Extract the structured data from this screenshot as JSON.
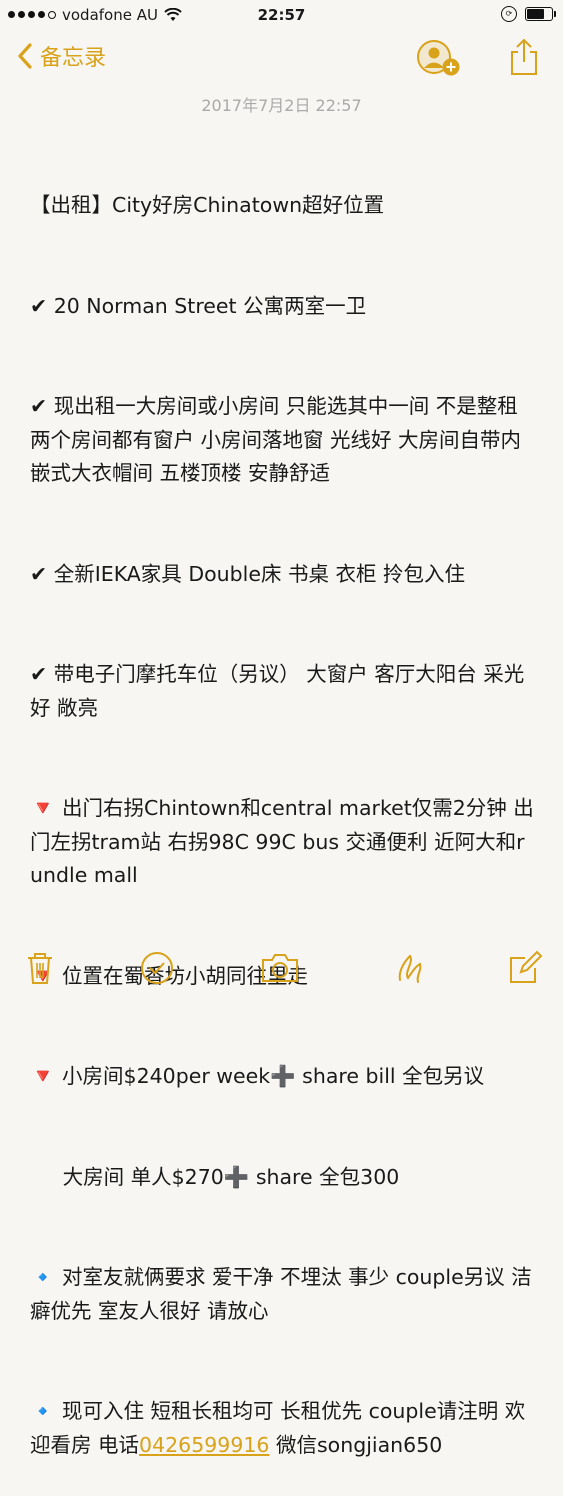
{
  "status_bar": {
    "carrier": "vodafone AU",
    "time": "22:57",
    "battery_level": 0.75,
    "signal_bars_filled": 4,
    "signal_bars_total": 5
  },
  "nav": {
    "back_label": "备忘录"
  },
  "note": {
    "date": "2017年7月2日 22:57",
    "lines": [
      "【出租】City好房Chinatown超好位置",
      "✔ 20 Norman Street 公寓两室一卫",
      "✔ 现出租一大房间或小房间 只能选其中一间 不是整租 两个房间都有窗户 小房间落地窗 光线好 大房间自带内嵌式大衣帽间 五楼顶楼 安静舒适",
      "✔ 全新IEKA家具 Double床 书桌 衣柜 拎包入住",
      "✔ 带电子门摩托车位（另议） 大窗户 客厅大阳台 采光好 敞亮",
      "🔻 出门右拐Chintown和central market仅需2分钟 出门左拐tram站 右拐98C 99C bus 交通便利 近阿大和rundle mall",
      "🔻 位置在蜀香坊小胡同往里走",
      "🔻 小房间$240per week➕ share bill 全包另议",
      "     大房间 单人$270➕ share 全包300",
      "🔹 对室友就俩要求 爱干净 不埋汰 事少 couple另议 洁癖优先 室友人很好 请放心"
    ],
    "last_line_prefix": "🔹 现可入住 短租长租均可 长租优先 couple请注明 欢迎看房 电话",
    "phone": "0426599916",
    "last_line_suffix": " 微信songjian650"
  },
  "colors": {
    "accent": "#d9a21b",
    "background": "#f7f6f2",
    "date_text": "#a9a9a9"
  },
  "toolbar_icons": [
    "trash-icon",
    "checklist-icon",
    "camera-icon",
    "sketch-icon",
    "compose-icon"
  ]
}
